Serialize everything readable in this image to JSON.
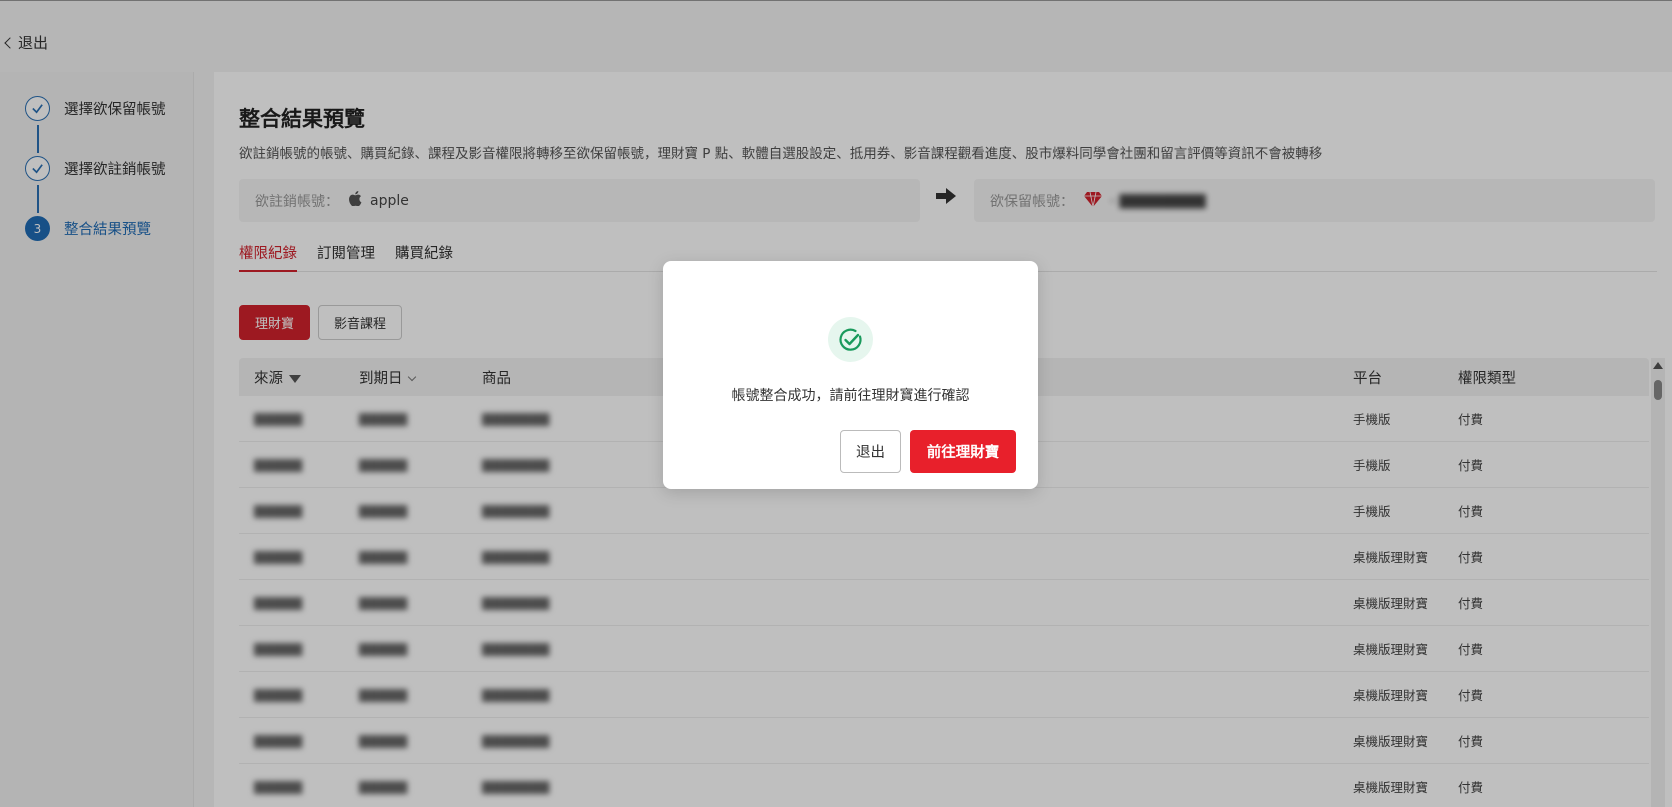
{
  "header": {
    "back_label": "退出"
  },
  "sidebar": {
    "steps": [
      {
        "label": "選擇欲保留帳號",
        "state": "done"
      },
      {
        "label": "選擇欲註銷帳號",
        "state": "done"
      },
      {
        "label": "整合結果預覽",
        "number": "3",
        "state": "active"
      }
    ]
  },
  "main": {
    "title": "整合結果預覽",
    "description": "欲註銷帳號的帳號、購買紀錄、課程及影音權限將轉移至欲保留帳號，理財寶 P 點、軟體自選股設定、抵用券、影音課程觀看進度、股市爆料同學會社團和留言評價等資訊不會被轉移",
    "cancel_account": {
      "label": "欲註銷帳號：",
      "value": "apple",
      "icon": "apple-icon"
    },
    "keep_account": {
      "label": "欲保留帳號：",
      "icon": "diamond-icon"
    },
    "tabs": [
      "權限紀錄",
      "訂閱管理",
      "購買紀錄"
    ],
    "filters": [
      "理財寶",
      "影音課程"
    ],
    "table": {
      "headers": {
        "source": "來源",
        "expiry": "到期日",
        "product": "商品",
        "platform": "平台",
        "type": "權限類型"
      },
      "rows": [
        {
          "platform": "手機版",
          "type": "付費"
        },
        {
          "platform": "手機版",
          "type": "付費"
        },
        {
          "platform": "手機版",
          "type": "付費"
        },
        {
          "platform": "桌機版理財寶",
          "type": "付費"
        },
        {
          "platform": "桌機版理財寶",
          "type": "付費"
        },
        {
          "platform": "桌機版理財寶",
          "type": "付費"
        },
        {
          "platform": "桌機版理財寶",
          "type": "付費"
        },
        {
          "platform": "桌機版理財寶",
          "type": "付費"
        },
        {
          "platform": "桌機版理財寶",
          "type": "付費"
        }
      ]
    }
  },
  "modal": {
    "message": "帳號整合成功，請前往理財寶進行確認",
    "exit_label": "退出",
    "go_label": "前往理財寶",
    "icon": "success-check-icon"
  },
  "colors": {
    "brand_red": "#e8202b",
    "step_blue": "#1f6bb5",
    "success_green": "#1a9a5c"
  }
}
